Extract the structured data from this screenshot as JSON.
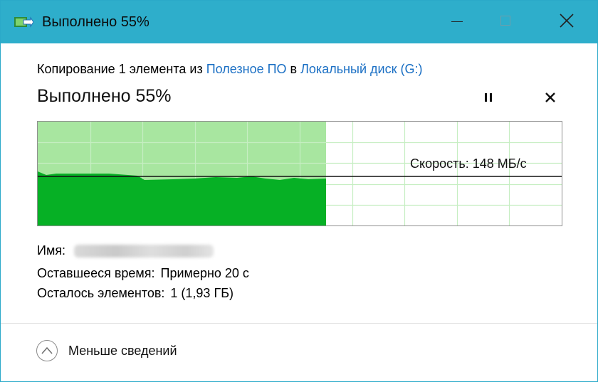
{
  "window": {
    "title": "Выполнено 55%",
    "icon": "file-copy-icon",
    "controls": {
      "minimize": "minimize-icon",
      "maximize": "maximize-icon",
      "close": "close-icon"
    }
  },
  "description": {
    "prefix": "Копирование 1 элемента из ",
    "source": "Полезное ПО",
    "middle": " в ",
    "destination": "Локальный диск (G:)"
  },
  "progress": {
    "heading": "Выполнено 55%",
    "percent": 55,
    "pause_icon": "pause-icon",
    "cancel_icon": "cancel-icon"
  },
  "speed": {
    "label": "Скорость: 148 МБ/с",
    "colors": {
      "done_area": "#06b025",
      "progress_fill": "#a8e6a0",
      "grid": "#c6eec2"
    }
  },
  "details": {
    "name_label": "Имя:",
    "name_value_hidden": true,
    "time_label": "Оставшееся время:",
    "time_value": "Примерно 20 с",
    "items_label": "Осталось элементов:",
    "items_value": "1 (1,93 ГБ)"
  },
  "footer": {
    "toggle_label": "Меньше сведений",
    "toggle_icon": "chevron-up-icon"
  }
}
